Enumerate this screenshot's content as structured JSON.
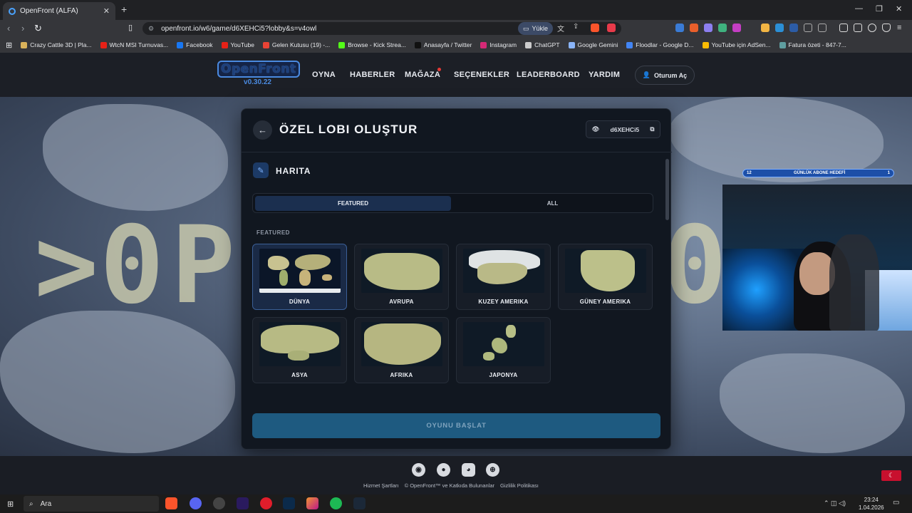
{
  "browser": {
    "tab_title": "OpenFront (ALFA)",
    "url": "openfront.io/w6/game/d6XEHCi5?lobby&s=v4owl",
    "yukle_label": "Yükle",
    "bookmarks": [
      {
        "label": "Crazy Cattle 3D | Pla...",
        "color": "#d9b25a"
      },
      {
        "label": "WtcN MSI Turnuvas...",
        "color": "#e62117"
      },
      {
        "label": "Facebook",
        "color": "#1877f2"
      },
      {
        "label": "YouTube",
        "color": "#e62117"
      },
      {
        "label": "Gelen Kutusu (19) -...",
        "color": "#ea4335"
      },
      {
        "label": "Browse - Kick Strea...",
        "color": "#53fc18"
      },
      {
        "label": "Anasayfa / Twitter",
        "color": "#111111"
      },
      {
        "label": "Instagram",
        "color": "#d62976"
      },
      {
        "label": "ChatGPT",
        "color": "#cccccc"
      },
      {
        "label": "Google Gemini",
        "color": "#8ab4f8"
      },
      {
        "label": "Floodlar - Google D...",
        "color": "#4285f4"
      },
      {
        "label": "YouTube için AdSen...",
        "color": "#fbbc04"
      },
      {
        "label": "Fatura özeti - 847-7...",
        "color": "#5f9ea0"
      }
    ]
  },
  "site": {
    "logo_name": "OpenFront",
    "version": "v0.30.22",
    "menu": [
      "OYNA",
      "HABERLER",
      "MAĞAZA",
      "SEÇENEKLER",
      "LEADERBOARD",
      "YARDIM"
    ],
    "login_label": "Oturum Aç"
  },
  "modal": {
    "title": "ÖZEL LOBI OLUŞTUR",
    "lobby_id": "d6XEHCi5",
    "section_title": "HARITA",
    "tabs": {
      "featured": "FEATURED",
      "all": "ALL"
    },
    "featured_label": "FEATURED",
    "maps": [
      {
        "label": "DÜNYA",
        "selected": true
      },
      {
        "label": "AVRUPA",
        "selected": false
      },
      {
        "label": "KUZEY AMERIKA",
        "selected": false
      },
      {
        "label": "GÜNEY AMERIKA",
        "selected": false
      },
      {
        "label": "ASYA",
        "selected": false
      },
      {
        "label": "AFRIKA",
        "selected": false
      },
      {
        "label": "JAPONYA",
        "selected": false
      }
    ],
    "start_button": "OYUNU BAŞLAT"
  },
  "footer": {
    "links": [
      "Hizmet Şartları",
      "© OpenFront™ ve Katkıda Bulunanlar",
      "Gizlilik Politikası"
    ]
  },
  "overlay": {
    "sub_goal_label": "GÜNLÜK ABONE HEDEFİ",
    "sub_current": "12",
    "sub_target": "1"
  },
  "taskbar": {
    "search_placeholder": "Ara",
    "time": "23:24",
    "date": "1.04.2026"
  },
  "colors": {
    "accent": "#1e5a80",
    "selected_card": "#1a2a46",
    "logo_blue": "#4a8ae0"
  }
}
